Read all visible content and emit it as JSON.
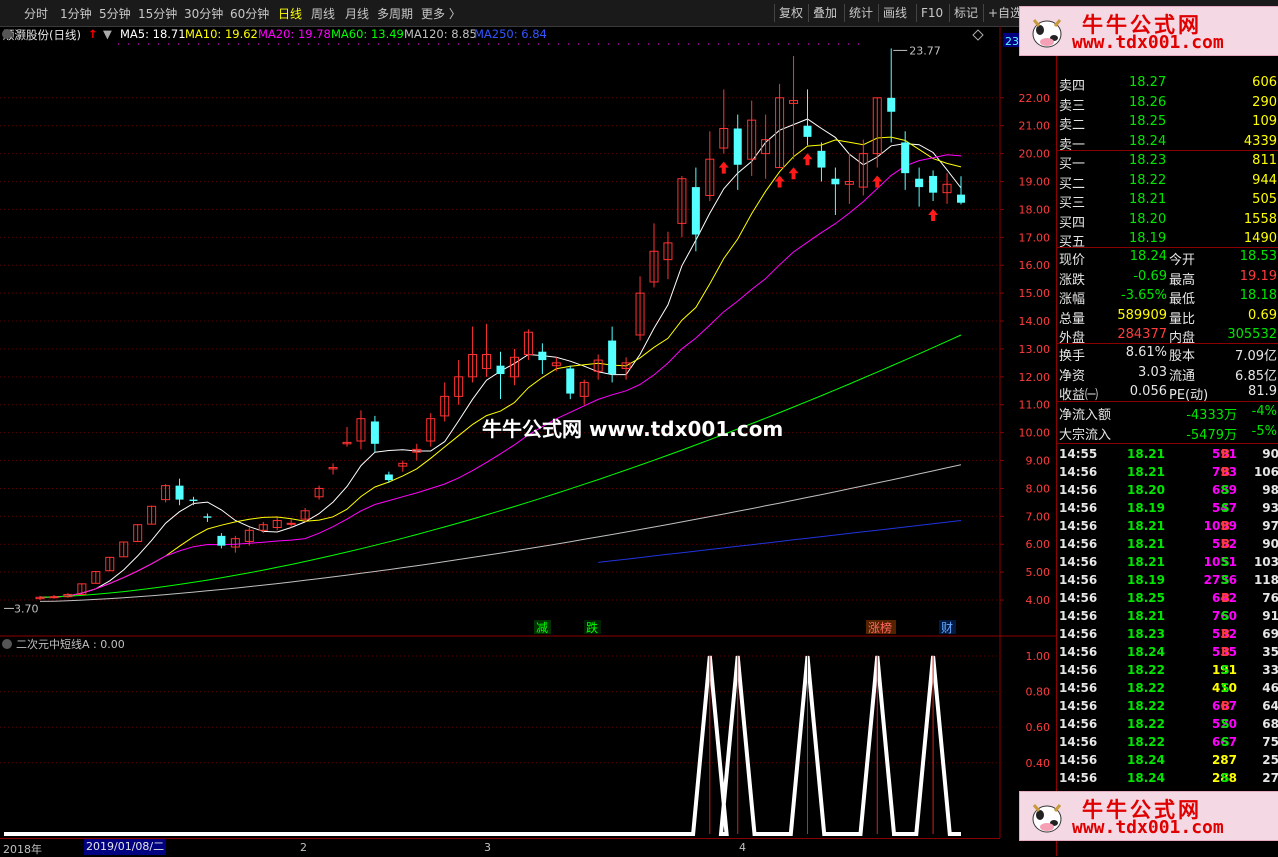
{
  "toolbar": {
    "periods": [
      "分时",
      "1分钟",
      "5分钟",
      "15分钟",
      "30分钟",
      "60分钟",
      "日线",
      "周线",
      "月线",
      "多周期",
      "更多 〉"
    ],
    "active_period": "日线",
    "right_buttons": [
      "复权",
      "叠加",
      "统计",
      "画线",
      "F10",
      "标记",
      "+自选"
    ]
  },
  "info": {
    "stock_name": "顺灏股份(日线)",
    "ma5": "MA5: 18.71",
    "ma10": "MA10: 19.62",
    "ma20": "MA20: 19.78",
    "ma60": "MA60: 13.49",
    "ma120": "MA120: 8.85",
    "ma250": "MA250: 6.84",
    "colors": {
      "ma5": "#ffffff",
      "ma10": "#ffff00",
      "ma20": "#ff00ff",
      "ma60": "#00ff00",
      "ma120": "#c0c0c0",
      "ma250": "#0000ff"
    }
  },
  "watermark": "牛牛公式网 www.tdx001.com",
  "main_chart": {
    "high_label": "23.77",
    "low_label": "3.70",
    "y_ticks": [
      "22.00",
      "21.00",
      "20.00",
      "19.00",
      "18.00",
      "17.00",
      "16.00",
      "15.00",
      "14.00",
      "13.00",
      "12.00",
      "11.00",
      "10.00",
      "9.00",
      "8.00",
      "7.00",
      "6.00",
      "5.00",
      "4.00"
    ],
    "event_labels": [
      "减",
      "跌",
      "涨榜",
      "财"
    ],
    "corner_value": "23"
  },
  "indicator": {
    "title": "二次元中短线A : 0.00",
    "y_ticks": [
      "1.00",
      "0.80",
      "0.60",
      "0.40"
    ],
    "signal_value": 1.0
  },
  "date_axis": {
    "labels": [
      "2018年",
      "2019/01/08/二",
      "2",
      "3",
      "4"
    ]
  },
  "chart_data": {
    "type": "candlestick",
    "title": "顺灏股份(日线)",
    "ylim": [
      3.5,
      24
    ],
    "candles": [
      {
        "o": 4.05,
        "c": 4.1,
        "h": 4.15,
        "l": 4.0
      },
      {
        "o": 4.1,
        "c": 4.12,
        "h": 4.18,
        "l": 4.05
      },
      {
        "o": 4.12,
        "c": 4.2,
        "h": 4.25,
        "l": 4.08
      },
      {
        "o": 4.2,
        "c": 4.58,
        "h": 4.6,
        "l": 4.18
      },
      {
        "o": 4.6,
        "c": 5.02,
        "h": 5.04,
        "l": 4.6
      },
      {
        "o": 5.05,
        "c": 5.53,
        "h": 5.55,
        "l": 5.05
      },
      {
        "o": 5.55,
        "c": 6.08,
        "h": 6.1,
        "l": 5.55
      },
      {
        "o": 6.1,
        "c": 6.7,
        "h": 6.72,
        "l": 6.1
      },
      {
        "o": 6.72,
        "c": 7.36,
        "h": 7.38,
        "l": 6.72
      },
      {
        "o": 7.6,
        "c": 8.1,
        "h": 8.15,
        "l": 7.5
      },
      {
        "o": 8.1,
        "c": 7.6,
        "h": 8.35,
        "l": 7.4
      },
      {
        "o": 7.6,
        "c": 7.55,
        "h": 7.7,
        "l": 7.4
      },
      {
        "o": 7.0,
        "c": 6.95,
        "h": 7.1,
        "l": 6.8
      },
      {
        "o": 6.3,
        "c": 5.95,
        "h": 6.4,
        "l": 5.85
      },
      {
        "o": 5.9,
        "c": 6.2,
        "h": 6.3,
        "l": 5.7
      },
      {
        "o": 6.1,
        "c": 6.5,
        "h": 6.6,
        "l": 5.95
      },
      {
        "o": 6.5,
        "c": 6.7,
        "h": 6.8,
        "l": 6.4
      },
      {
        "o": 6.6,
        "c": 6.85,
        "h": 6.95,
        "l": 6.5
      },
      {
        "o": 6.75,
        "c": 6.75,
        "h": 6.9,
        "l": 6.6
      },
      {
        "o": 6.9,
        "c": 7.2,
        "h": 7.3,
        "l": 6.8
      },
      {
        "o": 7.7,
        "c": 8.0,
        "h": 8.1,
        "l": 7.6
      },
      {
        "o": 8.7,
        "c": 8.75,
        "h": 8.9,
        "l": 8.5
      },
      {
        "o": 9.6,
        "c": 9.65,
        "h": 10.2,
        "l": 9.5
      },
      {
        "o": 9.7,
        "c": 10.5,
        "h": 10.8,
        "l": 9.4
      },
      {
        "o": 10.4,
        "c": 9.6,
        "h": 10.6,
        "l": 9.3
      },
      {
        "o": 8.5,
        "c": 8.3,
        "h": 8.6,
        "l": 8.2
      },
      {
        "o": 8.8,
        "c": 8.9,
        "h": 9.0,
        "l": 8.6
      },
      {
        "o": 9.3,
        "c": 9.4,
        "h": 9.6,
        "l": 9.0
      },
      {
        "o": 9.7,
        "c": 10.5,
        "h": 10.7,
        "l": 9.5
      },
      {
        "o": 10.6,
        "c": 11.3,
        "h": 11.8,
        "l": 10.4
      },
      {
        "o": 11.3,
        "c": 12.0,
        "h": 12.6,
        "l": 11.0
      },
      {
        "o": 12.0,
        "c": 12.8,
        "h": 13.8,
        "l": 11.8
      },
      {
        "o": 12.3,
        "c": 12.8,
        "h": 13.9,
        "l": 12.0
      },
      {
        "o": 12.4,
        "c": 12.1,
        "h": 12.9,
        "l": 11.2
      },
      {
        "o": 12.0,
        "c": 12.7,
        "h": 13.0,
        "l": 11.7
      },
      {
        "o": 12.8,
        "c": 13.6,
        "h": 13.7,
        "l": 12.6
      },
      {
        "o": 12.9,
        "c": 12.6,
        "h": 13.2,
        "l": 12.1
      },
      {
        "o": 12.4,
        "c": 12.5,
        "h": 12.7,
        "l": 12.2
      },
      {
        "o": 12.3,
        "c": 11.4,
        "h": 12.4,
        "l": 11.2
      },
      {
        "o": 11.3,
        "c": 11.8,
        "h": 11.9,
        "l": 11.0
      },
      {
        "o": 12.2,
        "c": 12.6,
        "h": 12.8,
        "l": 11.9
      },
      {
        "o": 13.3,
        "c": 12.1,
        "h": 13.8,
        "l": 11.8
      },
      {
        "o": 12.3,
        "c": 12.5,
        "h": 12.7,
        "l": 11.9
      },
      {
        "o": 13.5,
        "c": 15.0,
        "h": 15.6,
        "l": 13.3
      },
      {
        "o": 15.4,
        "c": 16.5,
        "h": 17.5,
        "l": 15.2
      },
      {
        "o": 16.2,
        "c": 16.8,
        "h": 17.2,
        "l": 15.5
      },
      {
        "o": 17.5,
        "c": 19.1,
        "h": 19.2,
        "l": 17.0
      },
      {
        "o": 18.8,
        "c": 17.1,
        "h": 19.5,
        "l": 16.5
      },
      {
        "o": 18.5,
        "c": 19.8,
        "h": 20.8,
        "l": 18.3
      },
      {
        "o": 20.2,
        "c": 20.9,
        "h": 22.3,
        "l": 20.0
      },
      {
        "o": 20.9,
        "c": 19.6,
        "h": 21.4,
        "l": 18.7
      },
      {
        "o": 19.8,
        "c": 21.2,
        "h": 21.9,
        "l": 19.2
      },
      {
        "o": 20.0,
        "c": 20.5,
        "h": 21.4,
        "l": 19.1
      },
      {
        "o": 19.5,
        "c": 22.0,
        "h": 22.5,
        "l": 19.5
      },
      {
        "o": 21.8,
        "c": 21.9,
        "h": 23.5,
        "l": 19.8
      },
      {
        "o": 21.0,
        "c": 20.6,
        "h": 22.3,
        "l": 20.3
      },
      {
        "o": 20.1,
        "c": 19.5,
        "h": 20.4,
        "l": 19.0
      },
      {
        "o": 19.1,
        "c": 18.9,
        "h": 19.5,
        "l": 17.8
      },
      {
        "o": 18.9,
        "c": 19.0,
        "h": 20.0,
        "l": 18.2
      },
      {
        "o": 18.8,
        "c": 20.0,
        "h": 20.5,
        "l": 18.5
      },
      {
        "o": 20.0,
        "c": 22.0,
        "h": 22.0,
        "l": 19.5
      },
      {
        "o": 22.0,
        "c": 21.5,
        "h": 23.77,
        "l": 20.4
      },
      {
        "o": 20.4,
        "c": 19.3,
        "h": 20.8,
        "l": 18.7
      },
      {
        "o": 19.1,
        "c": 18.8,
        "h": 19.5,
        "l": 18.1
      },
      {
        "o": 19.2,
        "c": 18.6,
        "h": 19.4,
        "l": 18.3
      },
      {
        "o": 18.6,
        "c": 18.9,
        "h": 19.3,
        "l": 18.2
      },
      {
        "o": 18.53,
        "c": 18.24,
        "h": 19.19,
        "l": 18.18
      }
    ],
    "signal_series": {
      "name": "二次元中短线A",
      "values_at_candles": {
        "48": 1,
        "50": 1,
        "55": 1,
        "60": 1,
        "64": 1
      }
    }
  },
  "panel": {
    "corner_code": "23",
    "asks": [
      {
        "label": "卖四",
        "price": "18.27",
        "vol": "606"
      },
      {
        "label": "卖三",
        "price": "18.26",
        "vol": "290"
      },
      {
        "label": "卖二",
        "price": "18.25",
        "vol": "109"
      },
      {
        "label": "卖一",
        "price": "18.24",
        "vol": "4339"
      }
    ],
    "bids": [
      {
        "label": "买一",
        "price": "18.23",
        "vol": "811"
      },
      {
        "label": "买二",
        "price": "18.22",
        "vol": "944"
      },
      {
        "label": "买三",
        "price": "18.21",
        "vol": "505"
      },
      {
        "label": "买四",
        "price": "18.20",
        "vol": "1558"
      },
      {
        "label": "买五",
        "price": "18.19",
        "vol": "1490"
      }
    ],
    "quote": [
      {
        "l1": "现价",
        "v1": "18.24",
        "l2": "今开",
        "v2": "18.53"
      },
      {
        "l1": "涨跌",
        "v1": "-0.69",
        "l2": "最高",
        "v2": "19.19"
      },
      {
        "l1": "涨幅",
        "v1": "-3.65%",
        "l2": "最低",
        "v2": "18.18"
      },
      {
        "l1": "总量",
        "v1": "589909",
        "l2": "量比",
        "v2": "0.69"
      },
      {
        "l1": "外盘",
        "v1": "284377",
        "l2": "内盘",
        "v2": "305532"
      }
    ],
    "fundamentals": [
      {
        "l1": "换手",
        "v1": "8.61%",
        "l2": "股本",
        "v2": "7.09亿"
      },
      {
        "l1": "净资",
        "v1": "3.03",
        "l2": "流通",
        "v2": "6.85亿"
      },
      {
        "l1": "收益㈠",
        "v1": "0.056",
        "l2": "PE(动)",
        "v2": "81.9"
      }
    ],
    "flows": [
      {
        "label": "净流入额",
        "value": "-4333万",
        "pct": "-4%"
      },
      {
        "label": "大宗流入",
        "value": "-5479万",
        "pct": "-5%"
      }
    ],
    "ticks": [
      {
        "t": "14:55",
        "p": "18.21",
        "v": "591",
        "s": "B",
        "n": "90"
      },
      {
        "t": "14:56",
        "p": "18.21",
        "v": "793",
        "s": "B",
        "n": "106"
      },
      {
        "t": "14:56",
        "p": "18.20",
        "v": "689",
        "s": "S",
        "n": "98"
      },
      {
        "t": "14:56",
        "p": "18.19",
        "v": "547",
        "s": "S",
        "n": "93"
      },
      {
        "t": "14:56",
        "p": "18.21",
        "v": "1099",
        "s": "B",
        "n": "97"
      },
      {
        "t": "14:56",
        "p": "18.21",
        "v": "552",
        "s": "B",
        "n": "90"
      },
      {
        "t": "14:56",
        "p": "18.21",
        "v": "1051",
        "s": "S",
        "n": "103"
      },
      {
        "t": "14:56",
        "p": "18.19",
        "v": "2736",
        "s": "S",
        "n": "118"
      },
      {
        "t": "14:56",
        "p": "18.25",
        "v": "642",
        "s": "B",
        "n": "76"
      },
      {
        "t": "14:56",
        "p": "18.21",
        "v": "760",
        "s": "S",
        "n": "91"
      },
      {
        "t": "14:56",
        "p": "18.23",
        "v": "532",
        "s": "B",
        "n": "69"
      },
      {
        "t": "14:56",
        "p": "18.24",
        "v": "535",
        "s": "B",
        "n": "35"
      },
      {
        "t": "14:56",
        "p": "18.22",
        "v": "191",
        "s": "S",
        "n": "33"
      },
      {
        "t": "14:56",
        "p": "18.22",
        "v": "410",
        "s": "S",
        "n": "46"
      },
      {
        "t": "14:56",
        "p": "18.22",
        "v": "667",
        "s": "B",
        "n": "64"
      },
      {
        "t": "14:56",
        "p": "18.22",
        "v": "520",
        "s": "S",
        "n": "68"
      },
      {
        "t": "14:56",
        "p": "18.22",
        "v": "667",
        "s": "S",
        "n": "75"
      },
      {
        "t": "14:56",
        "p": "18.24",
        "v": "287",
        "s": "",
        "n": "25"
      },
      {
        "t": "14:56",
        "p": "18.24",
        "v": "288",
        "s": "S",
        "n": "27"
      }
    ]
  },
  "banner": {
    "title": "牛牛公式网",
    "url": "www.tdx001.com"
  }
}
